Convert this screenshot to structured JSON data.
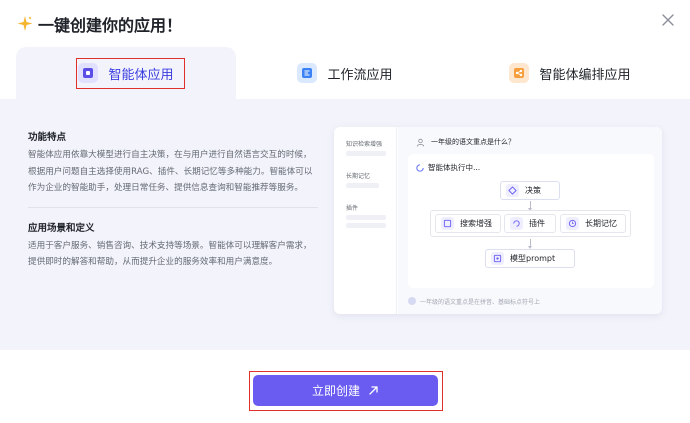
{
  "dialog": {
    "title": "一键创建你的应用！"
  },
  "tabs": [
    {
      "label": "智能体应用",
      "icon": "agent-app-icon",
      "selected": true
    },
    {
      "label": "工作流应用",
      "icon": "workflow-app-icon",
      "selected": false
    },
    {
      "label": "智能体编排应用",
      "icon": "agent-orchestration-icon",
      "selected": false
    }
  ],
  "description": {
    "features_title": "功能特点",
    "features_text": "智能体应用依靠大模型进行自主决策，在与用户进行自然语言交互的时候，根据用户问题自主选择使用RAG、插件、长期记忆等多种能力。智能体可以作为企业的智能助手，处理日常任务、提供信息查询和智能推荐等服务。",
    "scenarios_title": "应用场景和定义",
    "scenarios_text": "适用于客户服务、销售咨询、技术支持等场景。智能体可以理解客户需求，提供即时的解答和帮助，从而提升企业的服务效率和用户满意度。"
  },
  "preview": {
    "sidebar": [
      "知识检索增强",
      "长期记忆",
      "插件"
    ],
    "question": "一年级的语文重点是什么？",
    "status": "智能体执行中...",
    "nodes": {
      "decision": "决策",
      "search": "搜索增强",
      "plugin": "插件",
      "memory": "长期记忆",
      "model": "模型prompt"
    },
    "answer_preview": "一年级的语文重点是在拼音、基础标点符号上"
  },
  "footer": {
    "create_label": "立即创建",
    "create_icon": "arrow-up-right-icon"
  },
  "colors": {
    "accent": "#6a5cf0",
    "highlight_border": "#e0302a",
    "panel_bg": "#f3f4fb"
  }
}
